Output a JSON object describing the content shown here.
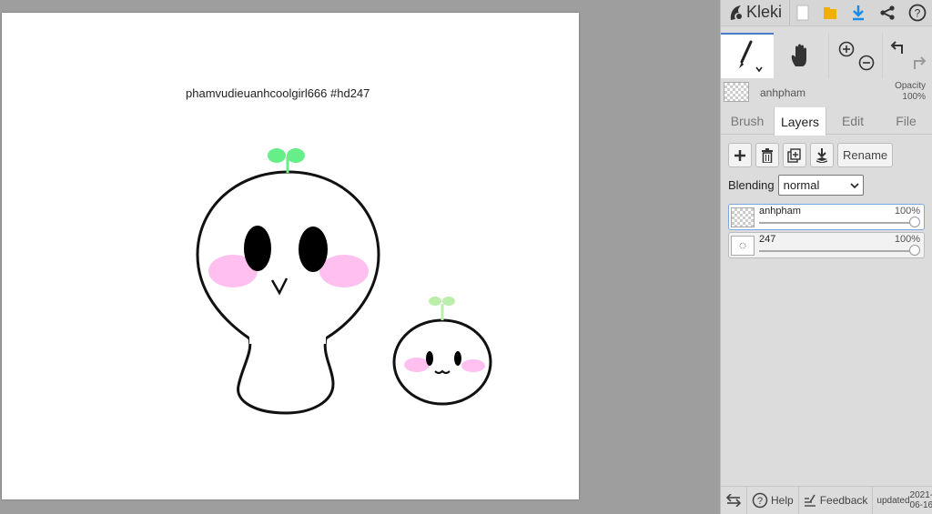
{
  "app": {
    "name": "Kleki"
  },
  "canvas": {
    "caption": "phamvudieuanhcoolgirl666 #hd247"
  },
  "current_layer": {
    "name": "anhpham",
    "opacity_label": "Opacity",
    "opacity_value": "100%"
  },
  "tabs": [
    {
      "label": "Brush"
    },
    {
      "label": "Layers",
      "active": true
    },
    {
      "label": "Edit"
    },
    {
      "label": "File"
    }
  ],
  "layers_panel": {
    "rename_label": "Rename",
    "blending_label": "Blending",
    "blending_value": "normal",
    "layers": [
      {
        "name": "anhpham",
        "opacity": "100%",
        "opacity_fraction": 1.0,
        "selected": true
      },
      {
        "name": "247",
        "opacity": "100%",
        "opacity_fraction": 1.0,
        "selected": false
      }
    ]
  },
  "bottom": {
    "help_label": "Help",
    "feedback_label": "Feedback",
    "updated_label": "updated",
    "updated_date": "2021-06-16"
  },
  "colors": {
    "accent": "#4a7cc8",
    "download_icon": "#1a8ae6",
    "save_icon": "#f0b000",
    "sprout_big": "#66ee88",
    "sprout_small": "#bbeeaa",
    "blush": "#ffc0f0"
  },
  "icons": [
    "kleki-logo-icon",
    "new-file-icon",
    "save-icon",
    "download-icon",
    "share-icon",
    "help-icon",
    "brush-icon",
    "hand-icon",
    "zoom-in-icon",
    "zoom-out-icon",
    "undo-icon",
    "redo-icon",
    "add-layer-icon",
    "delete-layer-icon",
    "duplicate-layer-icon",
    "merge-down-icon",
    "swap-icon",
    "feedback-icon"
  ]
}
